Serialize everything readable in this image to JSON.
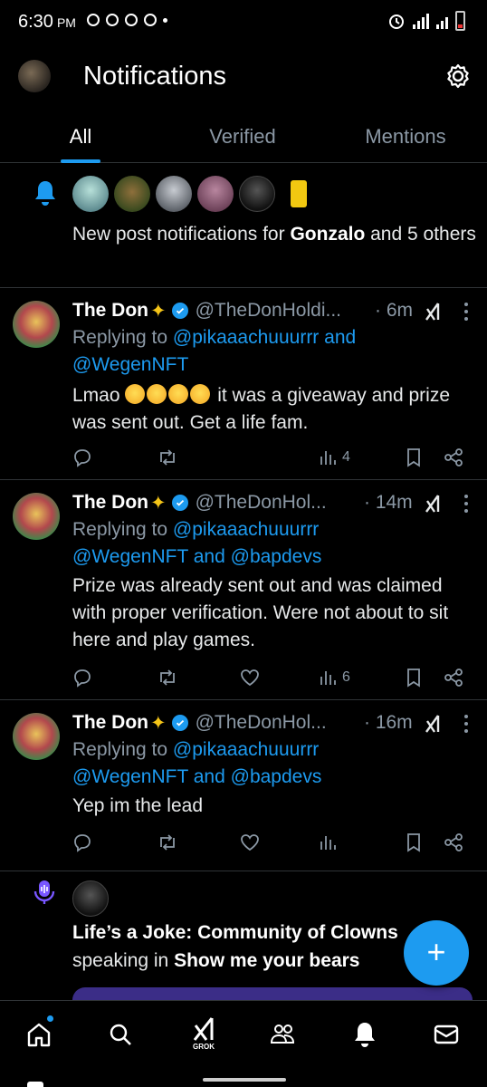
{
  "status_bar": {
    "time": "6:30",
    "ampm": "PM"
  },
  "header": {
    "title": "Notifications",
    "tabs": [
      {
        "label": "All",
        "active": true
      },
      {
        "label": "Verified",
        "active": false
      },
      {
        "label": "Mentions",
        "active": false
      }
    ]
  },
  "post_notification": {
    "prefix": "New post notifications for ",
    "name": "Gonzalo",
    "suffix": " and 5 others"
  },
  "posts": [
    {
      "name": "The Don",
      "handle": "@TheDonHoldi...",
      "time": "· 6m",
      "replying_prefix": "Replying to ",
      "replying_line1": "@pikaaachuuurrr and",
      "replying_line2": "@WegenNFT",
      "body_prefix": "Lmao ",
      "body_text": " it was a giveaway and prize was sent out. Get a life fam.",
      "views": "4"
    },
    {
      "name": "The Don",
      "handle": "@TheDonHol...",
      "time": "· 14m",
      "replying_prefix": "Replying to ",
      "replying_line1": "@pikaaachuuurrr",
      "replying_line2": "@WegenNFT and @bapdevs",
      "body_text": "Prize was already sent out and was claimed with proper verification. Were not about to sit here and play games.",
      "views": "6"
    },
    {
      "name": "The Don",
      "handle": "@TheDonHol...",
      "time": "· 16m",
      "replying_prefix": "Replying to ",
      "replying_line1": "@pikaaachuuurrr",
      "replying_line2": "@WegenNFT and @bapdevs",
      "body_text": "Yep im the lead",
      "views": ""
    }
  ],
  "spaces": {
    "title": "Life’s a Joke: Community of Clowns",
    "speaking_prefix": "speaking in ",
    "space_name": "Show me your bears"
  },
  "bottom_nav": {
    "grok_label": "GROK"
  },
  "colors": {
    "accent": "#1d9bf0",
    "muted": "#8b98a5",
    "divider": "#2f3336"
  }
}
